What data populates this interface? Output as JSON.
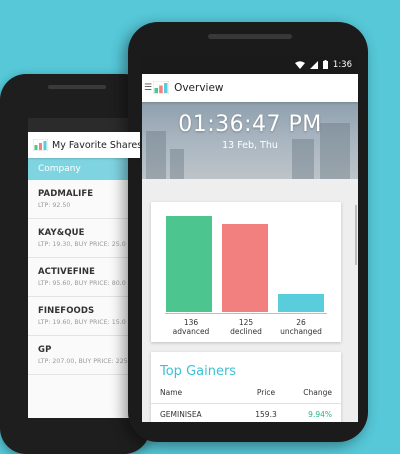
{
  "back_phone": {
    "app_title": "My Favorite Shares",
    "column_header": "Company",
    "items": [
      {
        "name": "PADMALIFE",
        "detail": "LTP: 92.50"
      },
      {
        "name": "KAY&QUE",
        "detail": "LTP: 19.30, BUY PRICE: 25.0"
      },
      {
        "name": "ACTIVEFINE",
        "detail": "LTP: 95.60, BUY PRICE: 80.0"
      },
      {
        "name": "FINEFOODS",
        "detail": "LTP: 19.60, BUY PRICE: 15.0"
      },
      {
        "name": "GP",
        "detail": "LTP: 207.00, BUY PRICE: 225."
      }
    ]
  },
  "front_phone": {
    "status_bar": {
      "time": "1:36",
      "icons": [
        "wifi-icon",
        "signal-icon",
        "battery-icon"
      ]
    },
    "app_title": "Overview",
    "clock": {
      "time": "01:36:47 PM",
      "date": "13 Feb, Thu"
    },
    "market_summary": {
      "advanced_count": "136",
      "advanced_label": "advanced",
      "declined_count": "125",
      "declined_label": "declined",
      "unchanged_count": "26",
      "unchanged_label": "unchanged"
    },
    "top_gainers": {
      "title": "Top Gainers",
      "columns": [
        "Name",
        "Price",
        "Change"
      ],
      "rows": [
        {
          "name": "GEMINISEA",
          "price": "159.3",
          "change": "9.94%"
        }
      ]
    }
  },
  "colors": {
    "background": "#56c8d8",
    "advanced": "#4dc58f",
    "declined": "#f2807f",
    "unchanged": "#5acddd",
    "accent": "#3cc1d5",
    "positive_change": "#27b38a"
  },
  "chart_data": {
    "type": "bar",
    "categories": [
      "advanced",
      "declined",
      "unchanged"
    ],
    "values": [
      136,
      125,
      26
    ],
    "title": "",
    "xlabel": "",
    "ylabel": "",
    "ylim": [
      0,
      136
    ],
    "grid": false,
    "legend": "none"
  }
}
